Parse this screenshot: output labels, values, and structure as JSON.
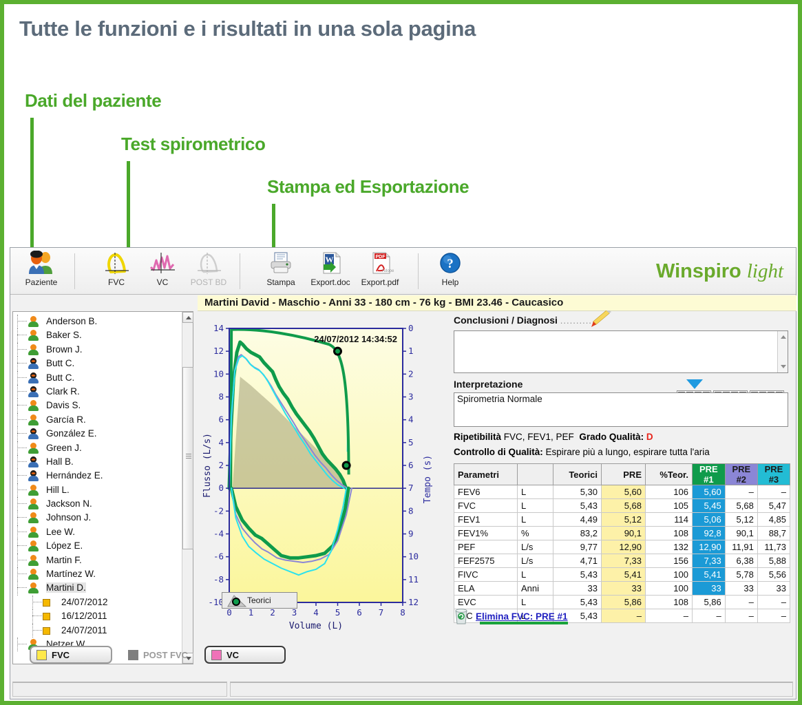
{
  "banner": {
    "headline": "Tutte le funzioni e i risultati in una sola pagina",
    "callouts": [
      {
        "label": "Dati del paziente"
      },
      {
        "label": "Test spirometrico"
      },
      {
        "label": "Stampa ed Esportazione"
      }
    ]
  },
  "toolbar": {
    "items": [
      {
        "label": "Paziente",
        "icon": "patients-icon"
      },
      {
        "label": "FVC",
        "icon": "fvc-loop-icon"
      },
      {
        "label": "VC",
        "icon": "vc-wave-icon"
      },
      {
        "label": "POST BD",
        "icon": "post-bd-loop-icon"
      },
      {
        "label": "Stampa",
        "icon": "printer-icon"
      },
      {
        "label": "Export.doc",
        "icon": "word-doc-icon"
      },
      {
        "label": "Export.pdf",
        "icon": "pdf-icon"
      },
      {
        "label": "Help",
        "icon": "help-question-icon"
      }
    ],
    "brand_main": "Winspiro",
    "brand_light": "light",
    "brand_color": "#6aaa2c"
  },
  "patient_header": "Martini David - Maschio - Anni 33 - 180 cm - 76 kg - BMI 23.46 - Caucasico",
  "tree": {
    "patients": [
      {
        "name": "Anderson B.",
        "avatar": "green"
      },
      {
        "name": "Baker S.",
        "avatar": "green"
      },
      {
        "name": "Brown J.",
        "avatar": "green"
      },
      {
        "name": "Butt C.",
        "avatar": "blue"
      },
      {
        "name": "Butt C.",
        "avatar": "blue"
      },
      {
        "name": "Clark R.",
        "avatar": "blue"
      },
      {
        "name": "Davis S.",
        "avatar": "green"
      },
      {
        "name": "García R.",
        "avatar": "green"
      },
      {
        "name": "González E.",
        "avatar": "blue"
      },
      {
        "name": "Green J.",
        "avatar": "green"
      },
      {
        "name": "Hall B.",
        "avatar": "blue"
      },
      {
        "name": "Hernández E.",
        "avatar": "blue"
      },
      {
        "name": "Hill L.",
        "avatar": "green"
      },
      {
        "name": "Jackson N.",
        "avatar": "green"
      },
      {
        "name": "Johnson J.",
        "avatar": "green"
      },
      {
        "name": "Lee W.",
        "avatar": "green"
      },
      {
        "name": "López E.",
        "avatar": "green"
      },
      {
        "name": "Martin F.",
        "avatar": "green"
      },
      {
        "name": "Martínez W.",
        "avatar": "green"
      },
      {
        "name": "Martini D.",
        "avatar": "green",
        "selected": true
      },
      {
        "name": "24/07/2012",
        "type": "session"
      },
      {
        "name": "16/12/2011",
        "type": "session"
      },
      {
        "name": "24/07/2011",
        "type": "session"
      },
      {
        "name": "Netzer W.",
        "avatar": "green"
      }
    ]
  },
  "chart_data": {
    "type": "line",
    "title": "",
    "timestamp": "24/07/2012  14:34:52",
    "xlabel": "Volume (L)",
    "ylabel": "Flusso (L/s)",
    "y2label": "Tempo (s)",
    "xlim": [
      0,
      8
    ],
    "ylim": [
      -10,
      14
    ],
    "y2lim": [
      0,
      12
    ],
    "xticks": [
      0,
      1,
      2,
      3,
      4,
      5,
      6,
      7,
      8
    ],
    "yticks": [
      -10,
      -8,
      -6,
      -4,
      -2,
      0,
      2,
      4,
      6,
      8,
      10,
      12,
      14
    ],
    "y2ticks": [
      0,
      1,
      2,
      3,
      4,
      5,
      6,
      7,
      8,
      9,
      10,
      11,
      12
    ],
    "grid": false,
    "legend": "Teorici",
    "series": [
      {
        "name": "PRE #1",
        "color": "#0f9b4b",
        "points": [
          [
            0.0,
            0.0
          ],
          [
            0.08,
            5.2
          ],
          [
            0.2,
            9.6
          ],
          [
            0.35,
            11.9
          ],
          [
            0.5,
            12.8
          ],
          [
            0.62,
            12.6
          ],
          [
            0.8,
            12.2
          ],
          [
            1.0,
            11.9
          ],
          [
            1.2,
            11.7
          ],
          [
            1.4,
            11.5
          ],
          [
            1.6,
            11.0
          ],
          [
            1.8,
            10.6
          ],
          [
            2.0,
            10.2
          ],
          [
            2.15,
            9.5
          ],
          [
            2.3,
            8.9
          ],
          [
            2.5,
            8.3
          ],
          [
            2.7,
            7.8
          ],
          [
            2.9,
            7.1
          ],
          [
            3.1,
            6.5
          ],
          [
            3.3,
            6.0
          ],
          [
            3.5,
            5.5
          ],
          [
            3.7,
            5.0
          ],
          [
            3.9,
            4.4
          ],
          [
            4.1,
            3.7
          ],
          [
            4.3,
            3.0
          ],
          [
            4.5,
            2.5
          ],
          [
            4.7,
            2.1
          ],
          [
            4.9,
            1.7
          ],
          [
            5.1,
            1.2
          ],
          [
            5.25,
            0.7
          ],
          [
            5.35,
            0.2
          ],
          [
            5.4,
            0.0
          ]
        ]
      },
      {
        "name": "PRE #2",
        "color": "#8b86d6",
        "points": [
          [
            0.0,
            0.0
          ],
          [
            0.1,
            6.0
          ],
          [
            0.25,
            10.3
          ],
          [
            0.42,
            11.5
          ],
          [
            0.55,
            11.7
          ],
          [
            0.75,
            11.4
          ],
          [
            0.95,
            10.9
          ],
          [
            1.15,
            10.6
          ],
          [
            1.35,
            10.4
          ],
          [
            1.55,
            10.0
          ],
          [
            1.75,
            9.5
          ],
          [
            1.95,
            8.9
          ],
          [
            2.15,
            8.2
          ],
          [
            2.35,
            7.6
          ],
          [
            2.55,
            7.0
          ],
          [
            2.75,
            6.4
          ],
          [
            2.95,
            5.8
          ],
          [
            3.2,
            5.0
          ],
          [
            3.45,
            4.3
          ],
          [
            3.7,
            3.6
          ],
          [
            3.95,
            2.9
          ],
          [
            4.2,
            2.3
          ],
          [
            4.45,
            1.8
          ],
          [
            4.7,
            1.2
          ],
          [
            4.95,
            0.7
          ],
          [
            5.2,
            0.3
          ],
          [
            5.45,
            0.0
          ]
        ]
      },
      {
        "name": "PRE #3",
        "color": "#2ae2ee",
        "points": [
          [
            0.0,
            0.0
          ],
          [
            0.1,
            6.4
          ],
          [
            0.26,
            10.3
          ],
          [
            0.45,
            11.4
          ],
          [
            0.6,
            11.6
          ],
          [
            0.8,
            11.3
          ],
          [
            1.0,
            10.8
          ],
          [
            1.2,
            10.5
          ],
          [
            1.4,
            10.3
          ],
          [
            1.6,
            9.9
          ],
          [
            1.8,
            9.3
          ],
          [
            2.0,
            8.6
          ],
          [
            2.2,
            7.9
          ],
          [
            2.4,
            7.2
          ],
          [
            2.6,
            6.5
          ],
          [
            2.8,
            5.9
          ],
          [
            3.0,
            5.3
          ],
          [
            3.25,
            4.5
          ],
          [
            3.5,
            3.8
          ],
          [
            3.75,
            3.0
          ],
          [
            4.0,
            2.4
          ],
          [
            4.25,
            1.8
          ],
          [
            4.5,
            1.2
          ],
          [
            4.75,
            0.7
          ],
          [
            5.0,
            0.3
          ],
          [
            5.3,
            0.0
          ]
        ]
      },
      {
        "name": "Teorici",
        "color": "#9d9a72",
        "points": [
          [
            0.15,
            0.0
          ],
          [
            0.5,
            9.77
          ],
          [
            1.0,
            9.0
          ],
          [
            2.0,
            7.3
          ],
          [
            3.0,
            5.4
          ],
          [
            4.0,
            3.5
          ],
          [
            5.0,
            1.5
          ],
          [
            5.43,
            0.0
          ]
        ]
      }
    ],
    "inspiratory": [
      {
        "name": "PRE #1",
        "color": "#0f9b4b",
        "points": [
          [
            0.1,
            0.0
          ],
          [
            0.3,
            -1.6
          ],
          [
            0.6,
            -2.8
          ],
          [
            0.9,
            -3.5
          ],
          [
            1.2,
            -4.1
          ],
          [
            1.5,
            -4.4
          ],
          [
            1.8,
            -4.9
          ],
          [
            2.1,
            -5.4
          ],
          [
            2.4,
            -5.9
          ],
          [
            2.8,
            -6.1
          ],
          [
            3.2,
            -6.1
          ],
          [
            3.6,
            -6.0
          ],
          [
            4.0,
            -5.9
          ],
          [
            4.4,
            -5.7
          ],
          [
            4.8,
            -5.0
          ],
          [
            5.1,
            -3.6
          ],
          [
            5.35,
            -1.8
          ],
          [
            5.5,
            0.0
          ]
        ]
      },
      {
        "name": "PRE #2",
        "color": "#8b86d6",
        "points": [
          [
            0.1,
            0.0
          ],
          [
            0.3,
            -2.3
          ],
          [
            0.6,
            -3.5
          ],
          [
            0.9,
            -4.2
          ],
          [
            1.2,
            -4.8
          ],
          [
            1.5,
            -5.3
          ],
          [
            1.8,
            -5.6
          ],
          [
            2.2,
            -6.1
          ],
          [
            2.6,
            -6.3
          ],
          [
            3.0,
            -6.4
          ],
          [
            3.4,
            -6.5
          ],
          [
            3.8,
            -6.4
          ],
          [
            4.2,
            -6.2
          ],
          [
            4.6,
            -5.8
          ],
          [
            5.0,
            -4.6
          ],
          [
            5.4,
            -2.3
          ],
          [
            5.65,
            0.0
          ]
        ]
      },
      {
        "name": "PRE #3",
        "color": "#2ae2ee",
        "points": [
          [
            0.1,
            0.0
          ],
          [
            0.3,
            -2.6
          ],
          [
            0.6,
            -4.2
          ],
          [
            0.9,
            -5.1
          ],
          [
            1.2,
            -5.6
          ],
          [
            1.6,
            -6.2
          ],
          [
            2.0,
            -6.6
          ],
          [
            2.4,
            -7.0
          ],
          [
            2.8,
            -7.3
          ],
          [
            3.2,
            -7.6
          ],
          [
            3.6,
            -7.3
          ],
          [
            4.0,
            -7.1
          ],
          [
            4.4,
            -6.6
          ],
          [
            4.7,
            -5.5
          ],
          [
            5.0,
            -3.6
          ],
          [
            5.25,
            -1.6
          ],
          [
            5.4,
            0.0
          ]
        ]
      }
    ],
    "markers": [
      {
        "x": 5.0,
        "y": 12.0,
        "label": "FEV1 marker"
      },
      {
        "x": 5.4,
        "y": 2.0,
        "label": "end marker"
      }
    ]
  },
  "curve_buttons": [
    {
      "label": "FVC",
      "swatch": "#ffe94a",
      "state": "selected"
    },
    {
      "label": "POST FVC",
      "swatch": "#7f7f7f",
      "state": "disabled"
    },
    {
      "label": "VC",
      "swatch": "#ef72b8",
      "state": "active"
    }
  ],
  "right_panel": {
    "conclusions_label": "Conclusioni / Diagnosi",
    "conclusions_dots": "..........",
    "conclusions_value": "",
    "conclusions_placeholder": "",
    "interpretation_label": "Interpretazione",
    "interpretation_value": "Spirometria Normale",
    "quality_bar": {
      "green": 4,
      "yellow": 4,
      "red": 4,
      "green_color": "#2fb540",
      "yellow_color": "#f6c325",
      "red_color": "#f0422a",
      "pointer_color": "#1f9ae0"
    },
    "repeatability_label": "Ripetibilità",
    "repeatability_value": "FVC, FEV1, PEF",
    "quality_grade_label": "Grado Qualità:",
    "quality_grade_value": "D",
    "quality_control_label": "Controllo di Qualità:",
    "quality_control_value": "Espirare più a lungo, espirare tutta l'aria",
    "delete_link": "Elimina FVC: PRE #1"
  },
  "table": {
    "columns": [
      "Parametri",
      "",
      "Teorici",
      "PRE",
      "%Teor.",
      "PRE #1",
      "PRE #2",
      "PRE #3"
    ],
    "header_colors": {
      "pre1": "#0f9b4b",
      "pre2": "#8b86d6",
      "pre3": "#23bcd4"
    },
    "rows": [
      {
        "param": "FEV6",
        "unit": "L",
        "teorici": "5,30",
        "pre": "5,60",
        "pct": "106",
        "pre1": "5,60",
        "pre2": "–",
        "pre3": "–"
      },
      {
        "param": "FVC",
        "unit": "L",
        "teorici": "5,43",
        "pre": "5,68",
        "pct": "105",
        "pre1": "5,45",
        "pre2": "5,68",
        "pre3": "5,47"
      },
      {
        "param": "FEV1",
        "unit": "L",
        "teorici": "4,49",
        "pre": "5,12",
        "pct": "114",
        "pre1": "5,06",
        "pre2": "5,12",
        "pre3": "4,85"
      },
      {
        "param": "FEV1%",
        "unit": "%",
        "teorici": "83,2",
        "pre": "90,1",
        "pct": "108",
        "pre1": "92,8",
        "pre2": "90,1",
        "pre3": "88,7"
      },
      {
        "param": "PEF",
        "unit": "L/s",
        "teorici": "9,77",
        "pre": "12,90",
        "pct": "132",
        "pre1": "12,90",
        "pre2": "11,91",
        "pre3": "11,73"
      },
      {
        "param": "FEF2575",
        "unit": "L/s",
        "teorici": "4,71",
        "pre": "7,33",
        "pct": "156",
        "pre1": "7,33",
        "pre2": "6,38",
        "pre3": "5,88"
      },
      {
        "param": "FIVC",
        "unit": "L",
        "teorici": "5,43",
        "pre": "5,41",
        "pct": "100",
        "pre1": "5,41",
        "pre2": "5,78",
        "pre3": "5,56"
      },
      {
        "param": "ELA",
        "unit": "Anni",
        "teorici": "33",
        "pre": "33",
        "pct": "100",
        "pre1": "33",
        "pre2": "33",
        "pre3": "33"
      },
      {
        "param": "EVC",
        "unit": "L",
        "teorici": "5,43",
        "pre": "5,86",
        "pct": "108",
        "pre1": "5,86",
        "pre2": "–",
        "pre3": "–",
        "pre1_plain": true
      },
      {
        "param": "IVC",
        "unit": "L",
        "teorici": "5,43",
        "pre": "–",
        "pct": "–",
        "pre1": "–",
        "pre2": "–",
        "pre3": "–",
        "pre1_plain": true
      }
    ]
  }
}
